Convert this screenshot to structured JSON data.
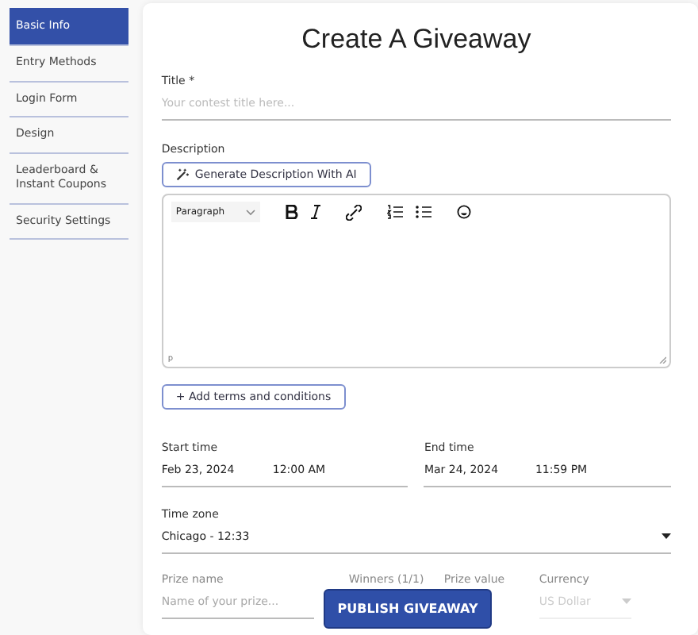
{
  "sidebar": {
    "items": [
      {
        "label": "Basic Info",
        "selected": true
      },
      {
        "label": "Entry Methods",
        "selected": false
      },
      {
        "label": "Login Form",
        "selected": false
      },
      {
        "label": "Design",
        "selected": false
      },
      {
        "label": "Leaderboard & Instant Coupons",
        "selected": false
      },
      {
        "label": "Security Settings",
        "selected": false
      }
    ]
  },
  "form": {
    "heading": "Create A Giveaway",
    "title_field": {
      "label": "Title *",
      "placeholder": "Your contest title here..."
    },
    "description": {
      "label": "Description",
      "ai_button": "Generate Description With AI",
      "block_format": "Paragraph",
      "status_path": "p"
    },
    "terms_button": "+ Add terms and conditions",
    "start": {
      "label": "Start time",
      "date": "Feb 23, 2024",
      "time": "12:00 AM"
    },
    "end": {
      "label": "End time",
      "date": "Mar 24, 2024",
      "time": "11:59 PM"
    },
    "time_zone": {
      "label": "Time zone",
      "value": "Chicago - 12:33"
    },
    "prize": {
      "name_label": "Prize name",
      "name_placeholder": "Name of your prize...",
      "winners_label": "Winners (1/1)",
      "value_label": "Prize value",
      "currency_label": "Currency",
      "currency": "US Dollar"
    }
  },
  "publish_button": "PUBLISH GIVEAWAY"
}
